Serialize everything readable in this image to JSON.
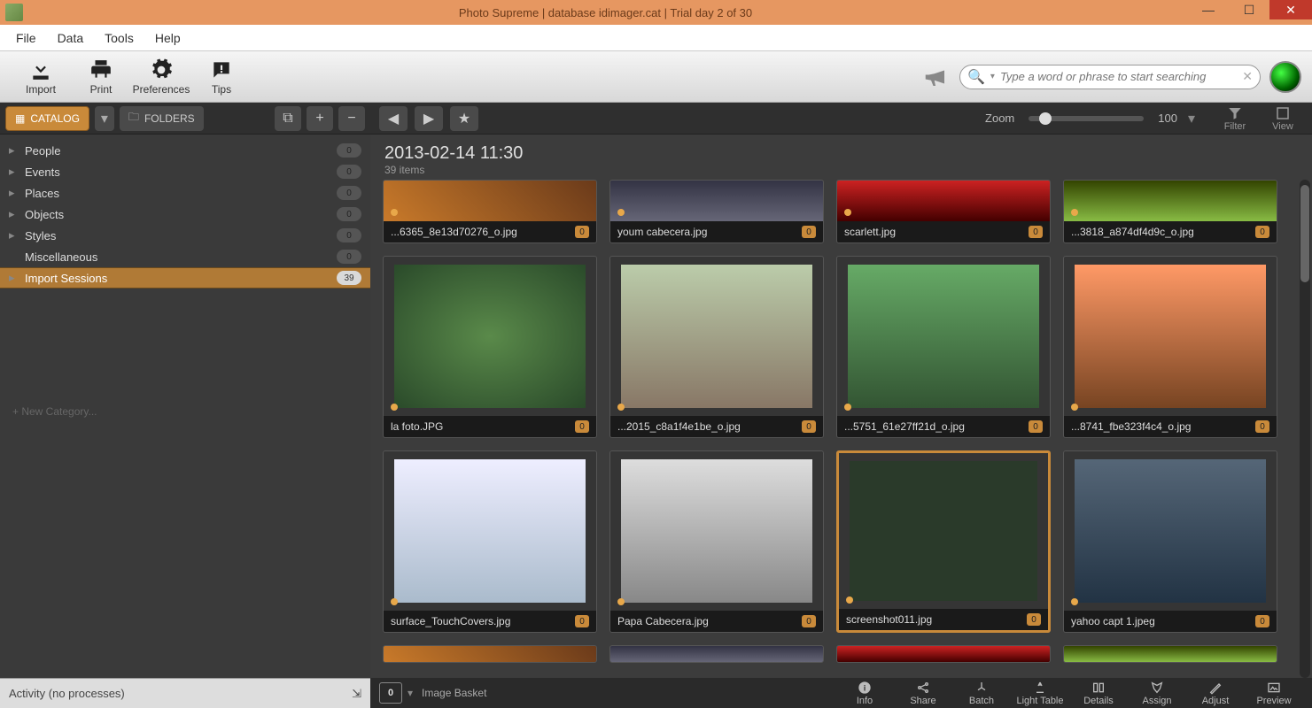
{
  "window": {
    "title": "Photo Supreme | database idimager.cat | Trial day 2 of 30"
  },
  "menu": {
    "file": "File",
    "data": "Data",
    "tools": "Tools",
    "help": "Help"
  },
  "toolbar": {
    "import": "Import",
    "print": "Print",
    "preferences": "Preferences",
    "tips": "Tips"
  },
  "search": {
    "placeholder": "Type a word or phrase to start searching"
  },
  "sidebar": {
    "tabs": {
      "catalog": "CATALOG",
      "folders": "FOLDERS"
    },
    "categories": [
      {
        "label": "People",
        "count": "0",
        "expandable": true,
        "selected": false
      },
      {
        "label": "Events",
        "count": "0",
        "expandable": true,
        "selected": false
      },
      {
        "label": "Places",
        "count": "0",
        "expandable": true,
        "selected": false
      },
      {
        "label": "Objects",
        "count": "0",
        "expandable": true,
        "selected": false
      },
      {
        "label": "Styles",
        "count": "0",
        "expandable": true,
        "selected": false
      },
      {
        "label": "Miscellaneous",
        "count": "0",
        "expandable": false,
        "selected": false
      },
      {
        "label": "Import Sessions",
        "count": "39",
        "expandable": true,
        "selected": true
      }
    ],
    "new_category": "+  New Category..."
  },
  "content_toolbar": {
    "zoom": "Zoom",
    "zoom_value": "100",
    "filter": "Filter",
    "view": "View"
  },
  "grid": {
    "header_date": "2013-02-14 11:30",
    "header_count": "39 items",
    "thumbs_row1": [
      {
        "fn": "...6365_8e13d70276_o.jpg",
        "cnt": "0"
      },
      {
        "fn": "youm cabecera.jpg",
        "cnt": "0"
      },
      {
        "fn": "scarlett.jpg",
        "cnt": "0"
      },
      {
        "fn": "...3818_a874df4d9c_o.jpg",
        "cnt": "0"
      }
    ],
    "thumbs_row2": [
      {
        "fn": "la foto.JPG",
        "cnt": "0"
      },
      {
        "fn": "...2015_c8a1f4e1be_o.jpg",
        "cnt": "0"
      },
      {
        "fn": "...5751_61e27ff21d_o.jpg",
        "cnt": "0"
      },
      {
        "fn": "...8741_fbe323f4c4_o.jpg",
        "cnt": "0"
      }
    ],
    "thumbs_row3": [
      {
        "fn": "surface_TouchCovers.jpg",
        "cnt": "0"
      },
      {
        "fn": "Papa Cabecera.jpg",
        "cnt": "0"
      },
      {
        "fn": "screenshot011.jpg",
        "cnt": "0",
        "selected": true
      },
      {
        "fn": "yahoo capt 1.jpeg",
        "cnt": "0"
      }
    ]
  },
  "bottombar": {
    "basket_count": "0",
    "basket_label": "Image Basket",
    "info": "Info",
    "share": "Share",
    "batch": "Batch",
    "lighttable": "Light Table",
    "details": "Details",
    "assign": "Assign",
    "adjust": "Adjust",
    "preview": "Preview"
  },
  "status": {
    "activity": "Activity (no processes)"
  }
}
